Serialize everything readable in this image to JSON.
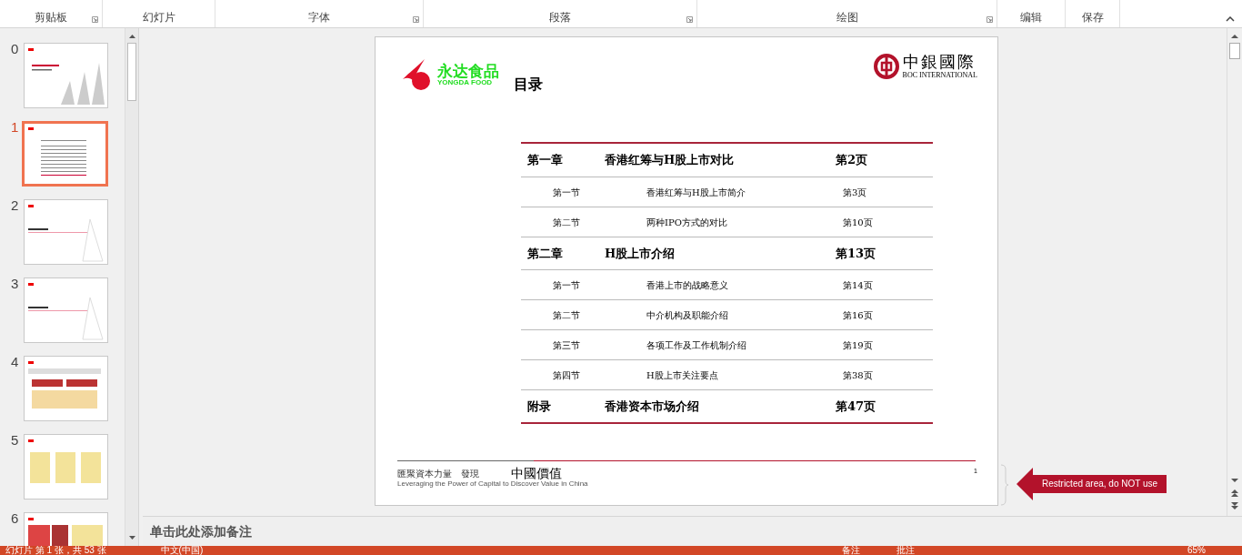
{
  "ribbon": {
    "groups": [
      {
        "label": "剪贴板",
        "launcher": true
      },
      {
        "label": "幻灯片",
        "launcher": false
      },
      {
        "label": "字体",
        "launcher": true
      },
      {
        "label": "段落",
        "launcher": true
      },
      {
        "label": "绘图",
        "launcher": true
      },
      {
        "label": "编辑",
        "launcher": false
      },
      {
        "label": "保存",
        "launcher": false
      }
    ]
  },
  "thumbnails": [
    {
      "number": "0",
      "selected": false,
      "kind": "cover"
    },
    {
      "number": "1",
      "selected": true,
      "kind": "toc"
    },
    {
      "number": "2",
      "selected": false,
      "kind": "divider"
    },
    {
      "number": "3",
      "selected": false,
      "kind": "divider"
    },
    {
      "number": "4",
      "selected": false,
      "kind": "diagram"
    },
    {
      "number": "5",
      "selected": false,
      "kind": "grid"
    },
    {
      "number": "6",
      "selected": false,
      "kind": "panel"
    }
  ],
  "slide": {
    "brand_left": {
      "name": "永达食品",
      "subtitle": "YONGDA FOOD"
    },
    "title": "目录",
    "brand_right": {
      "name": "中銀國際",
      "subtitle": "BOC INTERNATIONAL"
    },
    "toc": [
      {
        "kind": "chapter",
        "label": "第一章",
        "title": "香港红筹与H股上市对比",
        "page": "第2页"
      },
      {
        "kind": "section",
        "label": "第一节",
        "title": "香港红筹与H股上市简介",
        "page": "第3页"
      },
      {
        "kind": "section",
        "label": "第二节",
        "title": "两种IPO方式的对比",
        "page": "第10页"
      },
      {
        "kind": "chapter",
        "label": "第二章",
        "title": "H股上市介绍",
        "page": "第13页"
      },
      {
        "kind": "section",
        "label": "第一节",
        "title": "香港上市的战略意义",
        "page": "第14页"
      },
      {
        "kind": "section",
        "label": "第二节",
        "title": "中介机构及职能介绍",
        "page": "第16页"
      },
      {
        "kind": "section",
        "label": "第三节",
        "title": "各项工作及工作机制介绍",
        "page": "第19页"
      },
      {
        "kind": "section",
        "label": "第四节",
        "title": "H股上市关注要点",
        "page": "第38页"
      },
      {
        "kind": "chapter",
        "label": "附录",
        "title": "香港资本市场介绍",
        "page": "第47页"
      }
    ],
    "footer": {
      "tagline": "匯聚資本力量　發現",
      "tagline_en": "Leveraging the Power of Capital to",
      "mark": "中國價值",
      "mark_en": "Discover Value in China",
      "page_number": "1"
    }
  },
  "callout": "Restricted area, do NOT use",
  "notes": {
    "placeholder": "单击此处添加备注"
  },
  "status_bar": {
    "slide_info": "幻灯片 第 1 张，共 53 张",
    "language": "中文(中国)",
    "notes": "备注",
    "comments": "批注",
    "zoom": "65%"
  }
}
